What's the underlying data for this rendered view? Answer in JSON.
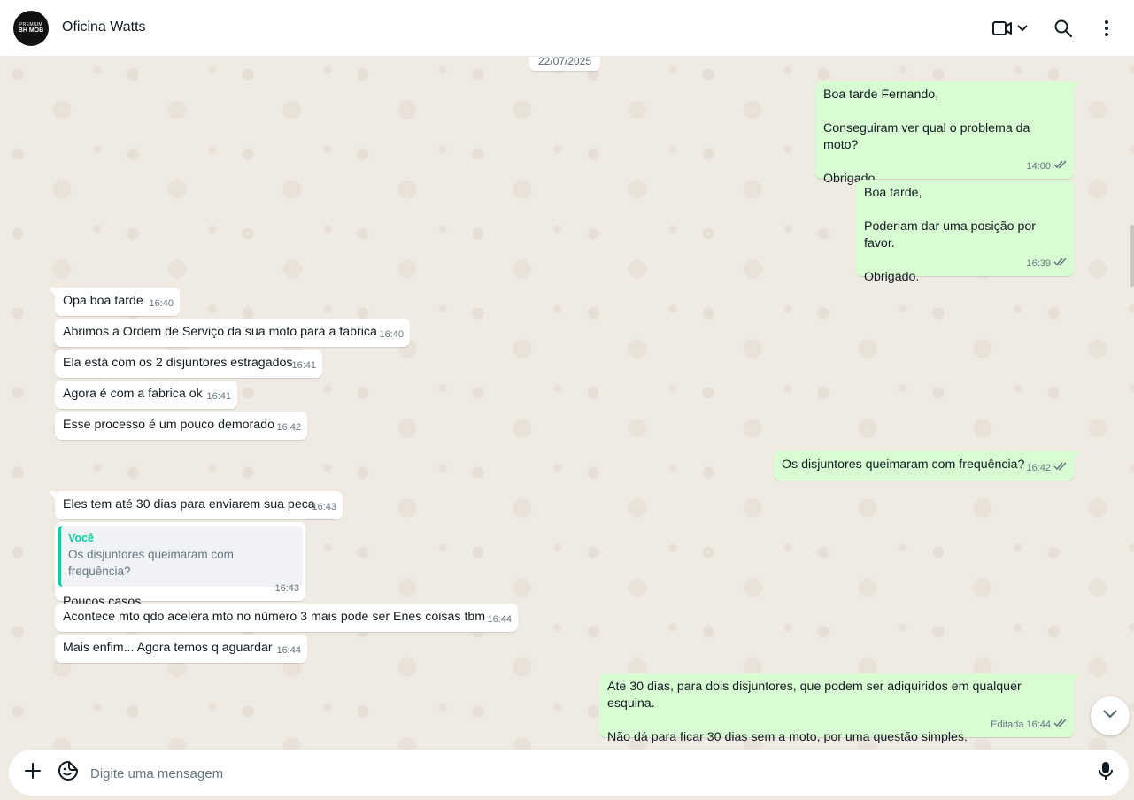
{
  "header": {
    "contact_name": "Oficina Watts",
    "avatar_icon": "business-logo-icon",
    "avatar_logo_text_top": "PREMIUM",
    "avatar_logo_text_main": "BH MOB",
    "video_call_icon": "video-camera-icon",
    "video_dropdown_icon": "chevron-down-icon",
    "search_icon": "search-icon",
    "menu_icon": "more-vertical-icon"
  },
  "chat": {
    "date_chip": "22/07/2025",
    "messages": [
      {
        "dir": "out",
        "text": "Boa tarde Fernando,\n\nConseguiram ver qual o problema da moto?\n\nObrigado.",
        "time": "14:00",
        "status": "read"
      },
      {
        "dir": "out",
        "text": "Boa tarde,\n\nPoderiam dar uma posição por favor.\n\nObrigado.",
        "time": "16:39",
        "status": "read"
      },
      {
        "dir": "in",
        "text": "Opa boa tarde",
        "time": "16:40"
      },
      {
        "dir": "in",
        "text": "Abrimos a Ordem de Serviço da sua moto para a fabrica",
        "time": "16:40"
      },
      {
        "dir": "in",
        "text": "Ela está com os 2 disjuntores estragados",
        "time": "16:41"
      },
      {
        "dir": "in",
        "text": "Agora é com a fabrica ok",
        "time": "16:41"
      },
      {
        "dir": "in",
        "text": "Esse processo é um pouco demorado",
        "time": "16:42"
      },
      {
        "dir": "out",
        "text": "Os disjuntores queimaram com frequência?",
        "time": "16:42",
        "status": "read"
      },
      {
        "dir": "in",
        "text": "Eles tem até 30 dias para enviarem sua peca",
        "time": "16:43"
      },
      {
        "dir": "in",
        "text": "Poucos casos",
        "time": "16:43",
        "quote": {
          "author": "Você",
          "text": "Os disjuntores queimaram com frequência?"
        }
      },
      {
        "dir": "in",
        "text": "Acontece mto qdo acelera mto no número 3 mais pode ser Enes coisas tbm",
        "time": "16:44"
      },
      {
        "dir": "in",
        "text": "Mais enfim... Agora temos q aguardar",
        "time": "16:44"
      },
      {
        "dir": "out",
        "text": "Ate 30 dias, para dois disjuntores, que podem ser adiquiridos em qualquer esquina.\n\nNão dá para ficar 30 dias sem a moto, por uma questão simples.",
        "time": "16:44",
        "edited": "Editada",
        "status": "read"
      }
    ],
    "scroll_down_icon": "chevron-down-icon",
    "read_receipt_icon": "double-check-icon"
  },
  "composer": {
    "attach_icon": "plus-icon",
    "sticker_icon": "sticker-icon",
    "placeholder": "Digite uma mensagem",
    "mic_icon": "microphone-icon"
  }
}
